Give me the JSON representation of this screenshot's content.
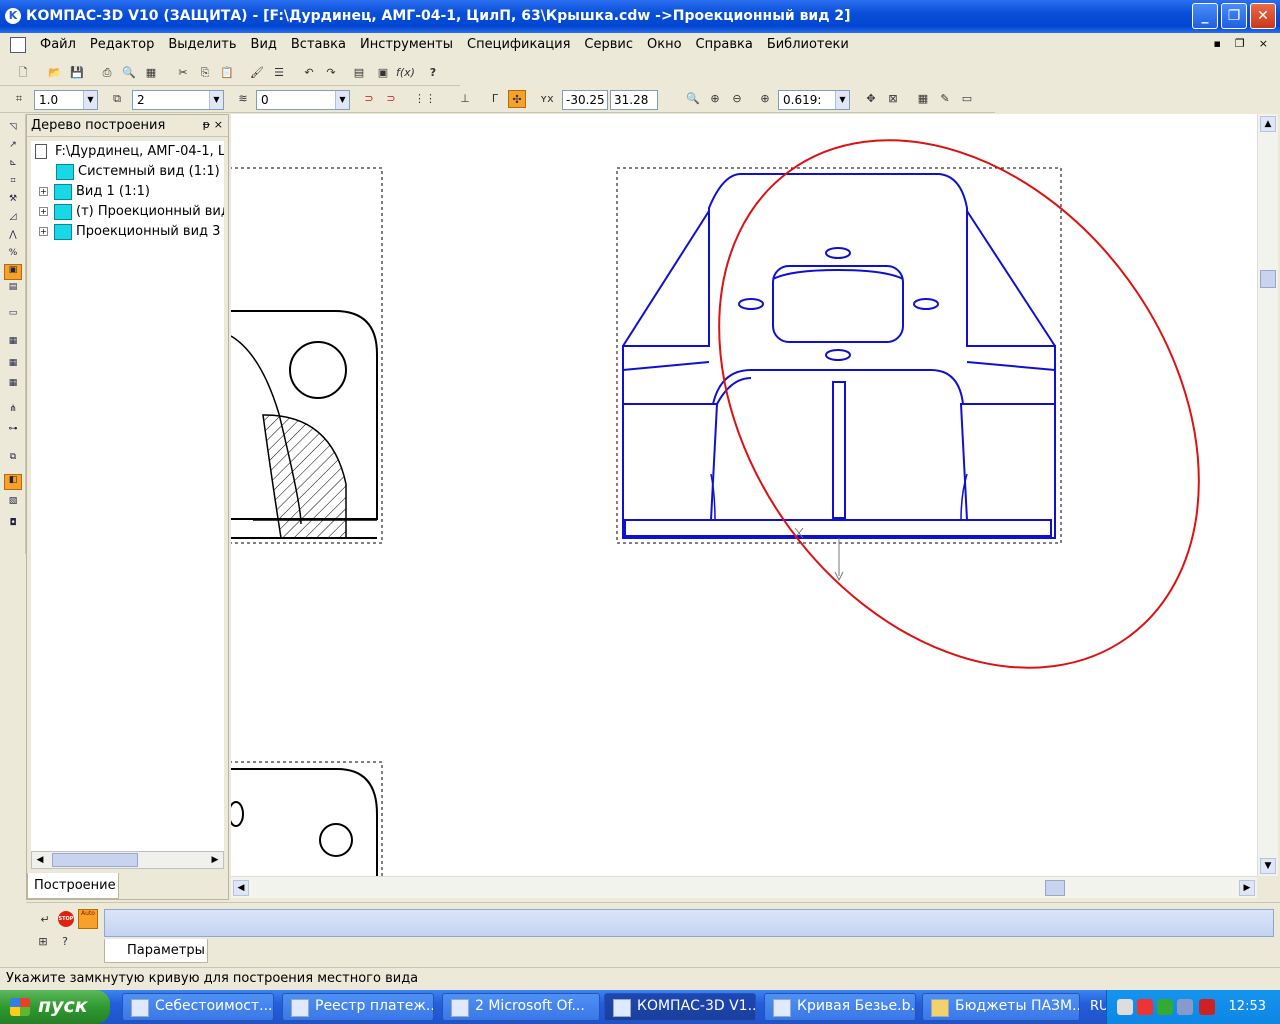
{
  "window": {
    "app_icon": "kompas-logo-icon",
    "title": "КОМПАС-3D V10 (ЗАЩИТА) - [F:\\Дурдинец, АМГ-04-1, ЦилП, 63\\Крышка.cdw ->Проекционный вид 2]",
    "buttons": {
      "minimize": "_",
      "maximize": "❐",
      "close": "✕"
    }
  },
  "menu": {
    "items": [
      "Файл",
      "Редактор",
      "Выделить",
      "Вид",
      "Вставка",
      "Инструменты",
      "Спецификация",
      "Сервис",
      "Окно",
      "Справка",
      "Библиотеки"
    ],
    "doc_controls": {
      "minimize": "▪",
      "restore": "❐",
      "close": "×"
    }
  },
  "toolbar_current": {
    "step": "1.0",
    "layer": "2",
    "style": "0",
    "coord_x": "-30.25",
    "coord_y": "31.28",
    "zoom": "0.619:"
  },
  "tree_panel": {
    "title": "Дерево построения",
    "pin": "ᵽ",
    "close": "×",
    "items": [
      {
        "label": "F:\\Дурдинец, АМГ-04-1, L",
        "expander": ""
      },
      {
        "label": "Системный вид (1:1)",
        "expander": ""
      },
      {
        "label": "Вид 1 (1:1)",
        "expander": "+"
      },
      {
        "label": "(т) Проекционный вид",
        "expander": "+"
      },
      {
        "label": "Проекционный вид 3",
        "expander": "+"
      }
    ],
    "tab": "Построение"
  },
  "param_panel": {
    "tab": "Параметры",
    "stop_label": "STOP",
    "auto_label": "Auto"
  },
  "statusbar": {
    "hint": "Укажите замкнутую кривую для построения местного вида"
  },
  "taskbar": {
    "start": "пуск",
    "tasks": [
      {
        "label": "Себестоимост...",
        "active": false
      },
      {
        "label": "Реестр платеж...",
        "active": false
      },
      {
        "label": "2 Microsoft Of...",
        "active": false
      },
      {
        "label": "КОМПАС-3D V1...",
        "active": true
      },
      {
        "label": "Кривая Безье.b...",
        "active": false
      },
      {
        "label": "Бюджеты ПАЗМ...",
        "active": false
      }
    ],
    "lang": "RU",
    "clock": "12:53"
  },
  "colors": {
    "titlebar": "#0a4fd8",
    "drawing_active": "#1010d0",
    "drawing_other": "#000000",
    "selection_curve": "#dd1111",
    "taskbar": "#245edb",
    "start_button": "#2f9a2f"
  }
}
